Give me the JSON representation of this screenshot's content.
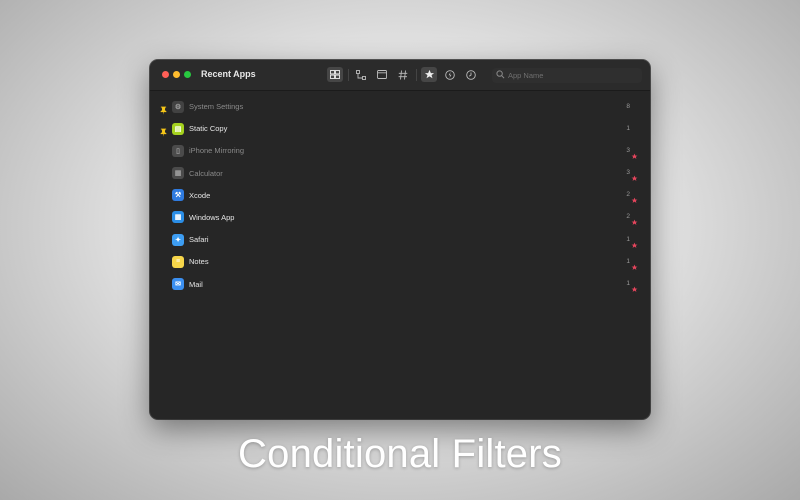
{
  "window": {
    "title": "Recent Apps",
    "traffic_lights": {
      "close": "#ff5f57",
      "minimize": "#febc2e",
      "zoom": "#28c840"
    }
  },
  "toolbar": {
    "tools": [
      {
        "name": "grid-view",
        "icon": "grid-icon",
        "active": true
      },
      {
        "name": "hierarchy-view",
        "icon": "hierarchy-icon",
        "active": false
      },
      {
        "name": "window-view",
        "icon": "window-icon",
        "active": false
      },
      {
        "name": "hash-view",
        "icon": "hash-icon",
        "active": false
      },
      {
        "name": "favorites-filter",
        "icon": "star-icon",
        "active": true
      },
      {
        "name": "power-filter",
        "icon": "lightning-icon",
        "active": false
      },
      {
        "name": "recent-filter",
        "icon": "clock-icon",
        "active": false
      }
    ]
  },
  "search": {
    "placeholder": "App Name",
    "value": ""
  },
  "apps": [
    {
      "name": "System Settings",
      "count": "8",
      "pinned": true,
      "starred": false,
      "dim": true,
      "icon": "gear-icon",
      "icon_color": "#5a5a5a"
    },
    {
      "name": "Static Copy",
      "count": "1",
      "pinned": true,
      "starred": false,
      "dim": false,
      "icon": "clipboard-icon",
      "icon_color": "#a5d21f"
    },
    {
      "name": "iPhone Mirroring",
      "count": "3",
      "pinned": false,
      "starred": true,
      "dim": true,
      "icon": "iphone-icon",
      "icon_color": "#6a6a6a"
    },
    {
      "name": "Calculator",
      "count": "3",
      "pinned": false,
      "starred": true,
      "dim": true,
      "icon": "calculator-icon",
      "icon_color": "#6a6a6a"
    },
    {
      "name": "Xcode",
      "count": "2",
      "pinned": false,
      "starred": true,
      "dim": false,
      "icon": "hammer-icon",
      "icon_color": "#2f7be0"
    },
    {
      "name": "Windows App",
      "count": "2",
      "pinned": false,
      "starred": true,
      "dim": false,
      "icon": "windows-icon",
      "icon_color": "#2b8ee6"
    },
    {
      "name": "Safari",
      "count": "1",
      "pinned": false,
      "starred": true,
      "dim": false,
      "icon": "compass-icon",
      "icon_color": "#3d9df2"
    },
    {
      "name": "Notes",
      "count": "1",
      "pinned": false,
      "starred": true,
      "dim": false,
      "icon": "notepad-icon",
      "icon_color": "#f7d64a"
    },
    {
      "name": "Mail",
      "count": "1",
      "pinned": false,
      "starred": true,
      "dim": false,
      "icon": "envelope-icon",
      "icon_color": "#3b8ff0"
    }
  ],
  "colors": {
    "pin": "#f5c518",
    "star": "#e8455d",
    "window_bg": "#262626"
  },
  "caption": "Conditional Filters"
}
